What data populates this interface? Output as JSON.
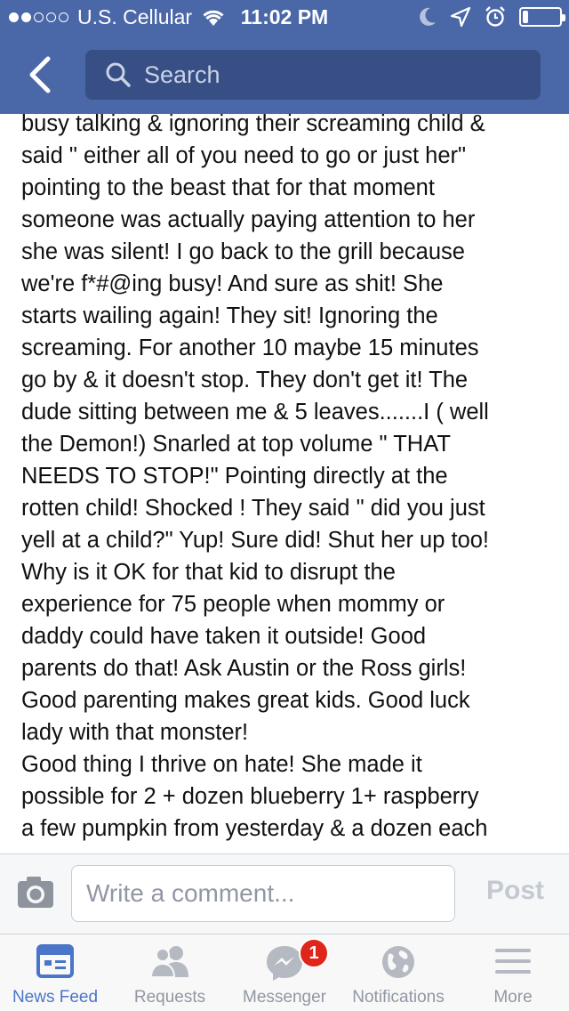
{
  "status_bar": {
    "carrier": "U.S. Cellular",
    "time": "11:02 PM",
    "signal_bars": 2,
    "battery_level": 0.15
  },
  "nav": {
    "search_placeholder": "Search"
  },
  "post": {
    "paragraphs": [
      "busy talking & ignoring their screaming child &\nsaid \" either all of you need to go or just her\"\npointing to the beast that for that moment\nsomeone was actually paying attention to her\nshe was silent!  I go back to the grill because\nwe're f*#@ing  busy!  And sure as shit! She\nstarts wailing again! They sit! Ignoring the\nscreaming. For another 10 maybe 15 minutes\ngo by & it doesn't stop.  They don't get it! The\ndude sitting between me & 5 leaves.......I  ( well\nthe Demon!) Snarled at top volume \" THAT\nNEEDS TO STOP!\" Pointing directly at the\nrotten child! Shocked ! They said \" did you just\nyell at a child?\" Yup! Sure did! Shut her up too!\nWhy is it OK for that kid to disrupt the\nexperience for 75 people when mommy or\ndaddy could have taken it outside!   Good\nparents do that!  Ask Austin or the Ross girls!\nGood parenting makes great kids. Good luck\nlady with that monster!",
      "Good thing I thrive on hate! She made it\npossible for 2 + dozen blueberry  1+ raspberry\na few pumpkin from yesterday & a dozen each"
    ]
  },
  "comment": {
    "placeholder": "Write a comment...",
    "post_label": "Post"
  },
  "tabs": [
    {
      "label": "News Feed",
      "icon": "news-feed-icon",
      "active": true
    },
    {
      "label": "Requests",
      "icon": "friends-icon",
      "active": false
    },
    {
      "label": "Messenger",
      "icon": "messenger-icon",
      "active": false,
      "badge": "1"
    },
    {
      "label": "Notifications",
      "icon": "globe-icon",
      "active": false
    },
    {
      "label": "More",
      "icon": "hamburger-icon",
      "active": false
    }
  ],
  "colors": {
    "brand_blue": "#4a67a8",
    "search_bg": "#374f85",
    "active_tab": "#4a75c8",
    "inactive_tab": "#9197a3",
    "badge_red": "#e0251b"
  }
}
